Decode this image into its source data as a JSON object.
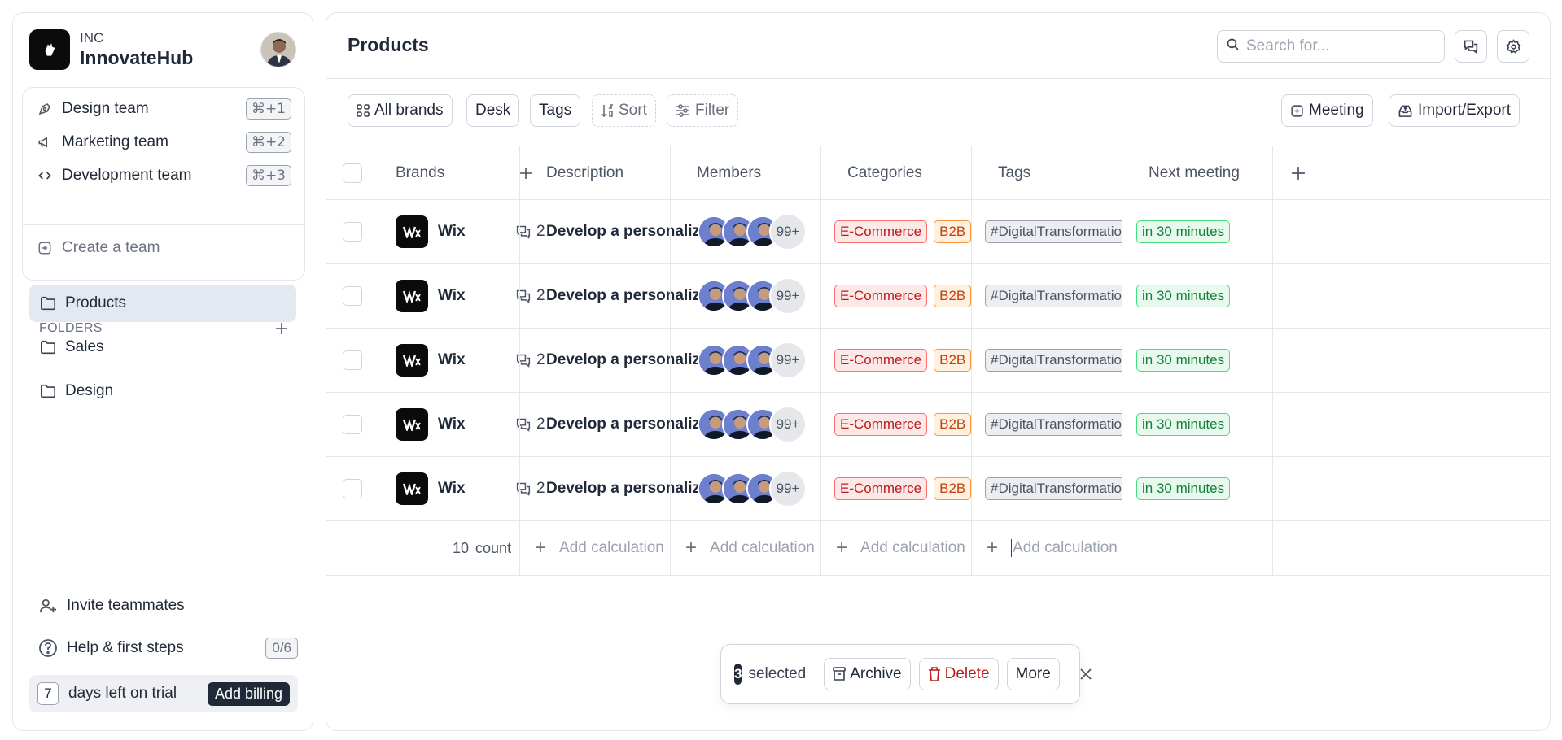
{
  "org": {
    "type": "INC",
    "name": "InnovateHub"
  },
  "teams": [
    {
      "label": "Design team",
      "shortcut": "⌘+1",
      "icon": "pen-nib-icon"
    },
    {
      "label": "Marketing team",
      "shortcut": "⌘+2",
      "icon": "megaphone-icon"
    },
    {
      "label": "Development team",
      "shortcut": "⌘+3",
      "icon": "code-icon"
    }
  ],
  "create_team_label": "Create a team",
  "folders": {
    "title": "FOLDERS",
    "items": [
      {
        "label": "Products",
        "active": true
      },
      {
        "label": "Sales",
        "active": false
      },
      {
        "label": "Design",
        "active": false
      }
    ]
  },
  "bottom": {
    "invite_label": "Invite teammates",
    "help_label": "Help & first steps",
    "help_progress": "0/6",
    "trial_days": "7",
    "trial_label": "days left on trial",
    "billing_label": "Add billing"
  },
  "header": {
    "title": "Products",
    "search_placeholder": "Search for..."
  },
  "toolbar": {
    "all_brands": "All brands",
    "desk": "Desk",
    "tags": "Tags",
    "sort": "Sort",
    "filter": "Filter",
    "meeting": "Meeting",
    "import_export": "Import/Export"
  },
  "table": {
    "columns": [
      "Brands",
      "Description",
      "Members",
      "Categories",
      "Tags",
      "Next meeting"
    ],
    "rows": [
      {
        "brand": "Wix",
        "comments": "2",
        "description": "Develop a personalized",
        "members_more": "99+",
        "categories": [
          "E-Commerce",
          "B2B"
        ],
        "tag": "#DigitalTransformation",
        "next_meeting": "in 30 minutes"
      },
      {
        "brand": "Wix",
        "comments": "2",
        "description": "Develop a personalized",
        "members_more": "99+",
        "categories": [
          "E-Commerce",
          "B2B"
        ],
        "tag": "#DigitalTransformation",
        "next_meeting": "in 30 minutes"
      },
      {
        "brand": "Wix",
        "comments": "2",
        "description": "Develop a personalized",
        "members_more": "99+",
        "categories": [
          "E-Commerce",
          "B2B"
        ],
        "tag": "#DigitalTransformation",
        "next_meeting": "in 30 minutes"
      },
      {
        "brand": "Wix",
        "comments": "2",
        "description": "Develop a personalized",
        "members_more": "99+",
        "categories": [
          "E-Commerce",
          "B2B"
        ],
        "tag": "#DigitalTransformation",
        "next_meeting": "in 30 minutes"
      },
      {
        "brand": "Wix",
        "comments": "2",
        "description": "Develop a personalized",
        "members_more": "99+",
        "categories": [
          "E-Commerce",
          "B2B"
        ],
        "tag": "#DigitalTransformation",
        "next_meeting": "in 30 minutes"
      }
    ],
    "footer": {
      "count_value": "10",
      "count_label": "count",
      "add_calc": "Add calculation"
    }
  },
  "selection": {
    "count": "3",
    "label": "selected",
    "archive": "Archive",
    "delete": "Delete",
    "more": "More"
  }
}
